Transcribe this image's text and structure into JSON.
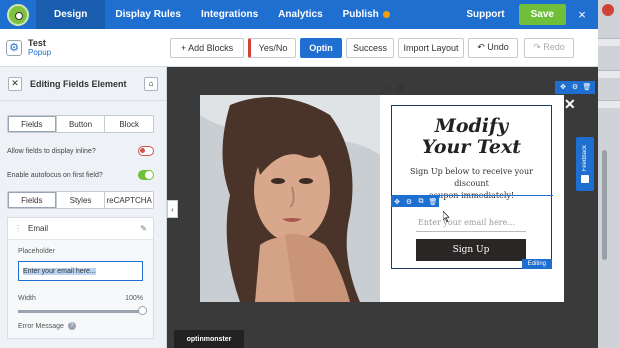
{
  "topnav": {
    "tabs": [
      {
        "label": "Design"
      },
      {
        "label": "Display Rules"
      },
      {
        "label": "Integrations"
      },
      {
        "label": "Analytics"
      },
      {
        "label": "Publish"
      }
    ],
    "support": "Support",
    "save": "Save",
    "close": "×"
  },
  "campaign": {
    "name": "Test",
    "type": "Popup"
  },
  "toolbar": {
    "add_blocks": "+ Add Blocks",
    "yesno": "Yes/No",
    "optin": "Optin",
    "success": "Success",
    "import_layout": "Import Layout",
    "undo": "↶ Undo",
    "redo": "↷ Redo"
  },
  "panel": {
    "title": "Editing Fields Element",
    "tabs1": [
      "Fields",
      "Button",
      "Block"
    ],
    "inline_label": "Allow fields to display inline?",
    "autofocus_label": "Enable autofocus on first field?",
    "tabs2": [
      "Fields",
      "Styles",
      "reCAPTCHA"
    ],
    "field_name": "Email",
    "placeholder_label": "Placeholder",
    "placeholder_value": "Enter your email here...",
    "width_label": "Width",
    "width_value": "100%",
    "width_fraction": 1.0,
    "error_label": "Error Message",
    "inline_enabled": false,
    "autofocus_enabled": true
  },
  "popup": {
    "headline_1": "Modify",
    "headline_2": "Your Text",
    "subtext_1": "Sign Up below to receive your discount",
    "subtext_2": "coupon immediately!",
    "email_placeholder": "Enter your email here...",
    "button": "Sign Up",
    "editing_tag": "Editing",
    "close": "✕"
  },
  "feedback": "Feedback",
  "brand": "optinmonster",
  "colors": {
    "nav_blue": "#1f6fd1",
    "save_green": "#6fbf3a",
    "toggle_red": "#d0554a"
  }
}
